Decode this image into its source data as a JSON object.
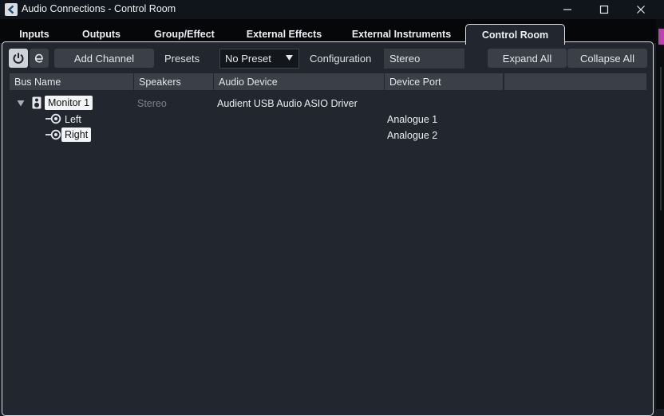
{
  "window": {
    "title": "Audio Connections - Control Room",
    "minimize_glyph": "—",
    "maximize_glyph": "☐",
    "close_glyph": "✕"
  },
  "tabs": [
    {
      "label": "Inputs"
    },
    {
      "label": "Outputs"
    },
    {
      "label": "Group/Effect"
    },
    {
      "label": "External Effects"
    },
    {
      "label": "External Instruments"
    },
    {
      "label": "Control Room"
    }
  ],
  "toolbar": {
    "power_icon": "power-icon",
    "edit_icon": "edit-e-icon",
    "add_channel_label": "Add Channel",
    "presets_label": "Presets",
    "preset_value": "No Preset",
    "configuration_label": "Configuration",
    "configuration_value": "Stereo",
    "expand_all_label": "Expand All",
    "collapse_all_label": "Collapse All"
  },
  "columns": [
    "Bus Name",
    "Speakers",
    "Audio Device",
    "Device Port",
    ""
  ],
  "rows": [
    {
      "bus_name": "Monitor 1",
      "speakers": "Stereo",
      "audio_device": "Audient USB Audio ASIO Driver",
      "device_port": "",
      "icon": "speaker-icon",
      "expanded": true
    },
    {
      "bus_name": "Left",
      "speakers": "",
      "audio_device": "",
      "device_port": "Analogue 1",
      "icon": "channel-pin-icon"
    },
    {
      "bus_name": "Right",
      "speakers": "",
      "audio_device": "",
      "device_port": "Analogue 2",
      "icon": "channel-pin-icon"
    }
  ],
  "colors": {
    "accent_pink": "#c13fb2",
    "title_bar": "#10151b",
    "panel": "#22262e"
  }
}
